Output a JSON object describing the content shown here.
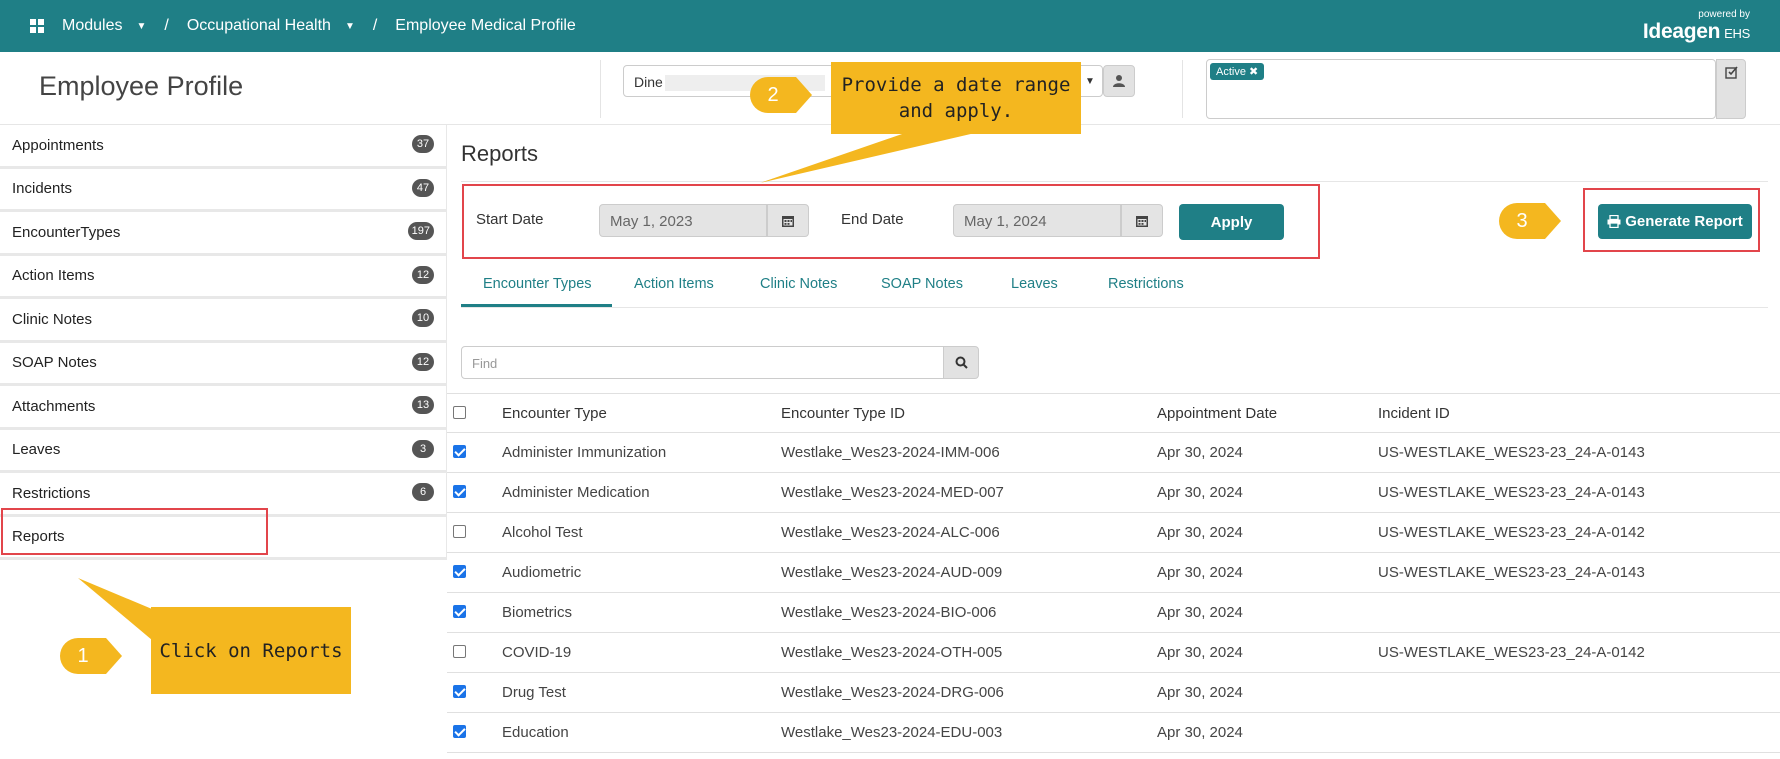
{
  "topbar": {
    "crumbs": [
      "Modules",
      "Occupational Health",
      "Employee Medical Profile"
    ],
    "brand_powered": "powered by",
    "brand_name": "Ideagen",
    "brand_suffix": "EHS"
  },
  "header": {
    "title": "Employee Profile",
    "employee_value": "Dine",
    "status_tag": "Active"
  },
  "sidebar": {
    "items": [
      {
        "label": "Appointments",
        "count": "37"
      },
      {
        "label": "Incidents",
        "count": "47"
      },
      {
        "label": "EncounterTypes",
        "count": "197"
      },
      {
        "label": "Action Items",
        "count": "12"
      },
      {
        "label": "Clinic Notes",
        "count": "10"
      },
      {
        "label": "SOAP Notes",
        "count": "12"
      },
      {
        "label": "Attachments",
        "count": "13"
      },
      {
        "label": "Leaves",
        "count": "3"
      },
      {
        "label": "Restrictions",
        "count": "6"
      },
      {
        "label": "Reports",
        "count": ""
      }
    ]
  },
  "main": {
    "title": "Reports",
    "start_label": "Start Date",
    "start_value": "May 1, 2023",
    "end_label": "End Date",
    "end_value": "May 1, 2024",
    "apply_label": "Apply",
    "generate_label": "Generate Report",
    "tabs": [
      "Encounter Types",
      "Action Items",
      "Clinic Notes",
      "SOAP Notes",
      "Leaves",
      "Restrictions"
    ],
    "find_placeholder": "Find",
    "columns": [
      "Encounter Type",
      "Encounter Type ID",
      "Appointment Date",
      "Incident ID"
    ],
    "rows": [
      {
        "checked": true,
        "type": "Administer Immunization",
        "id": "Westlake_Wes23-2024-IMM-006",
        "date": "Apr 30, 2024",
        "incident": "US-WESTLAKE_WES23-23_24-A-0143"
      },
      {
        "checked": true,
        "type": "Administer Medication",
        "id": "Westlake_Wes23-2024-MED-007",
        "date": "Apr 30, 2024",
        "incident": "US-WESTLAKE_WES23-23_24-A-0143"
      },
      {
        "checked": false,
        "type": "Alcohol Test",
        "id": "Westlake_Wes23-2024-ALC-006",
        "date": "Apr 30, 2024",
        "incident": "US-WESTLAKE_WES23-23_24-A-0142"
      },
      {
        "checked": true,
        "type": "Audiometric",
        "id": "Westlake_Wes23-2024-AUD-009",
        "date": "Apr 30, 2024",
        "incident": "US-WESTLAKE_WES23-23_24-A-0143"
      },
      {
        "checked": true,
        "type": "Biometrics",
        "id": "Westlake_Wes23-2024-BIO-006",
        "date": "Apr 30, 2024",
        "incident": ""
      },
      {
        "checked": false,
        "type": "COVID-19",
        "id": "Westlake_Wes23-2024-OTH-005",
        "date": "Apr 30, 2024",
        "incident": "US-WESTLAKE_WES23-23_24-A-0142"
      },
      {
        "checked": true,
        "type": "Drug Test",
        "id": "Westlake_Wes23-2024-DRG-006",
        "date": "Apr 30, 2024",
        "incident": ""
      },
      {
        "checked": true,
        "type": "Education",
        "id": "Westlake_Wes23-2024-EDU-003",
        "date": "Apr 30, 2024",
        "incident": ""
      }
    ]
  },
  "callouts": {
    "step1_number": "1",
    "step1_text": "Click on Reports",
    "step2_number": "2",
    "step2_text": "Provide a date range and apply.",
    "step3_number": "3"
  },
  "colors": {
    "brand": "#1f7f86",
    "callout": "#f4b71f",
    "highlight": "#e2454b",
    "checkbox": "#1a73e8"
  },
  "icons": [
    "grid-icon",
    "chevron-down-icon",
    "user-icon",
    "edit-icon",
    "calendar-icon",
    "print-icon",
    "search-icon",
    "close-icon"
  ]
}
